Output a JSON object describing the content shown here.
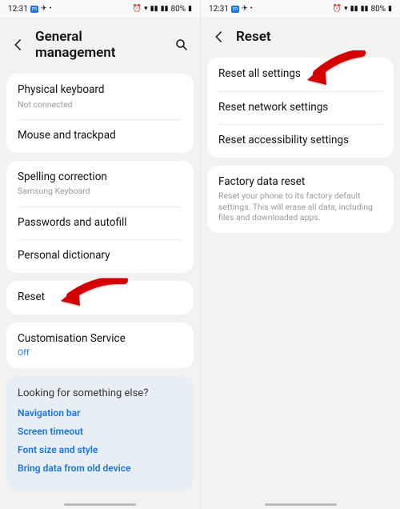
{
  "statusbar": {
    "time": "12:31",
    "battery": "80%"
  },
  "left": {
    "header": {
      "title": "General management"
    },
    "group1": [
      {
        "label": "Physical keyboard",
        "sub": "Not connected"
      },
      {
        "label": "Mouse and trackpad"
      }
    ],
    "group2": [
      {
        "label": "Spelling correction",
        "sub": "Samsung Keyboard"
      },
      {
        "label": "Passwords and autofill"
      },
      {
        "label": "Personal dictionary"
      }
    ],
    "group3": [
      {
        "label": "Reset"
      }
    ],
    "group4": [
      {
        "label": "Customisation Service",
        "sub": "Off",
        "subColor": "blue"
      }
    ],
    "tip": {
      "title": "Looking for something else?",
      "links": [
        "Navigation bar",
        "Screen timeout",
        "Font size and style",
        "Bring data from old device"
      ]
    }
  },
  "right": {
    "header": {
      "title": "Reset"
    },
    "group1": [
      {
        "label": "Reset all settings"
      },
      {
        "label": "Reset network settings"
      },
      {
        "label": "Reset accessibility settings"
      }
    ],
    "group2": [
      {
        "label": "Factory data reset",
        "sub": "Reset your phone to its factory default settings. This will erase all data, including files and downloaded apps."
      }
    ]
  }
}
